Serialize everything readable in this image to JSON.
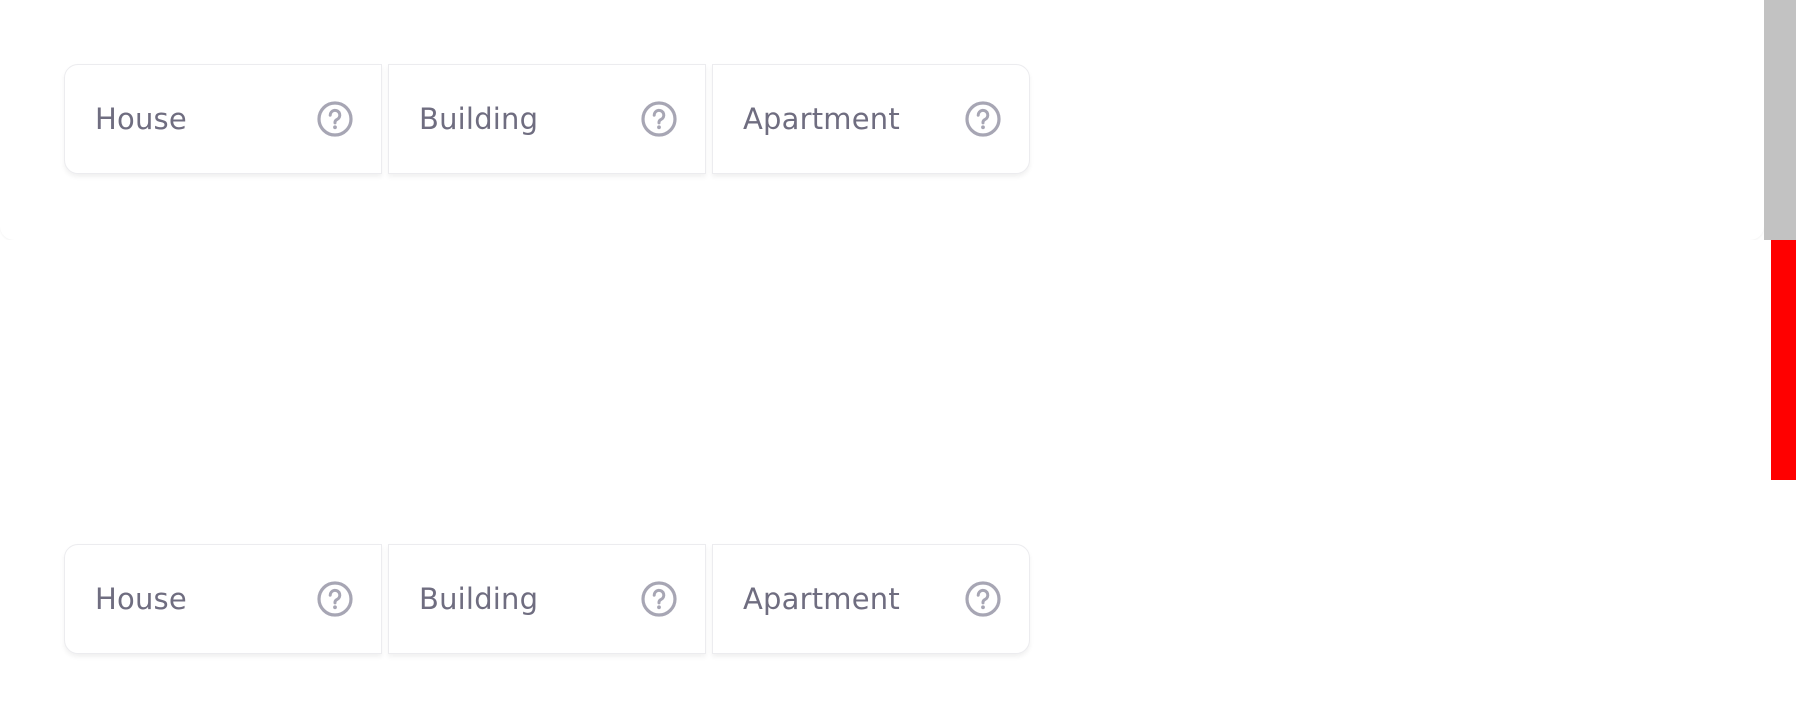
{
  "groups": [
    {
      "options": [
        {
          "label": "House",
          "help_icon": "help-circle-icon"
        },
        {
          "label": "Building",
          "help_icon": "help-circle-icon"
        },
        {
          "label": "Apartment",
          "help_icon": "help-circle-icon"
        }
      ]
    },
    {
      "options": [
        {
          "label": "House",
          "help_icon": "help-circle-icon"
        },
        {
          "label": "Building",
          "help_icon": "help-circle-icon"
        },
        {
          "label": "Apartment",
          "help_icon": "help-circle-icon"
        }
      ]
    }
  ],
  "colors": {
    "label": "#6f6d80",
    "icon": "#a7a6b4",
    "border": "#ececef",
    "scrollbar_thumb": "#c2c2c2",
    "scrollbar_marker": "#ff0000"
  }
}
